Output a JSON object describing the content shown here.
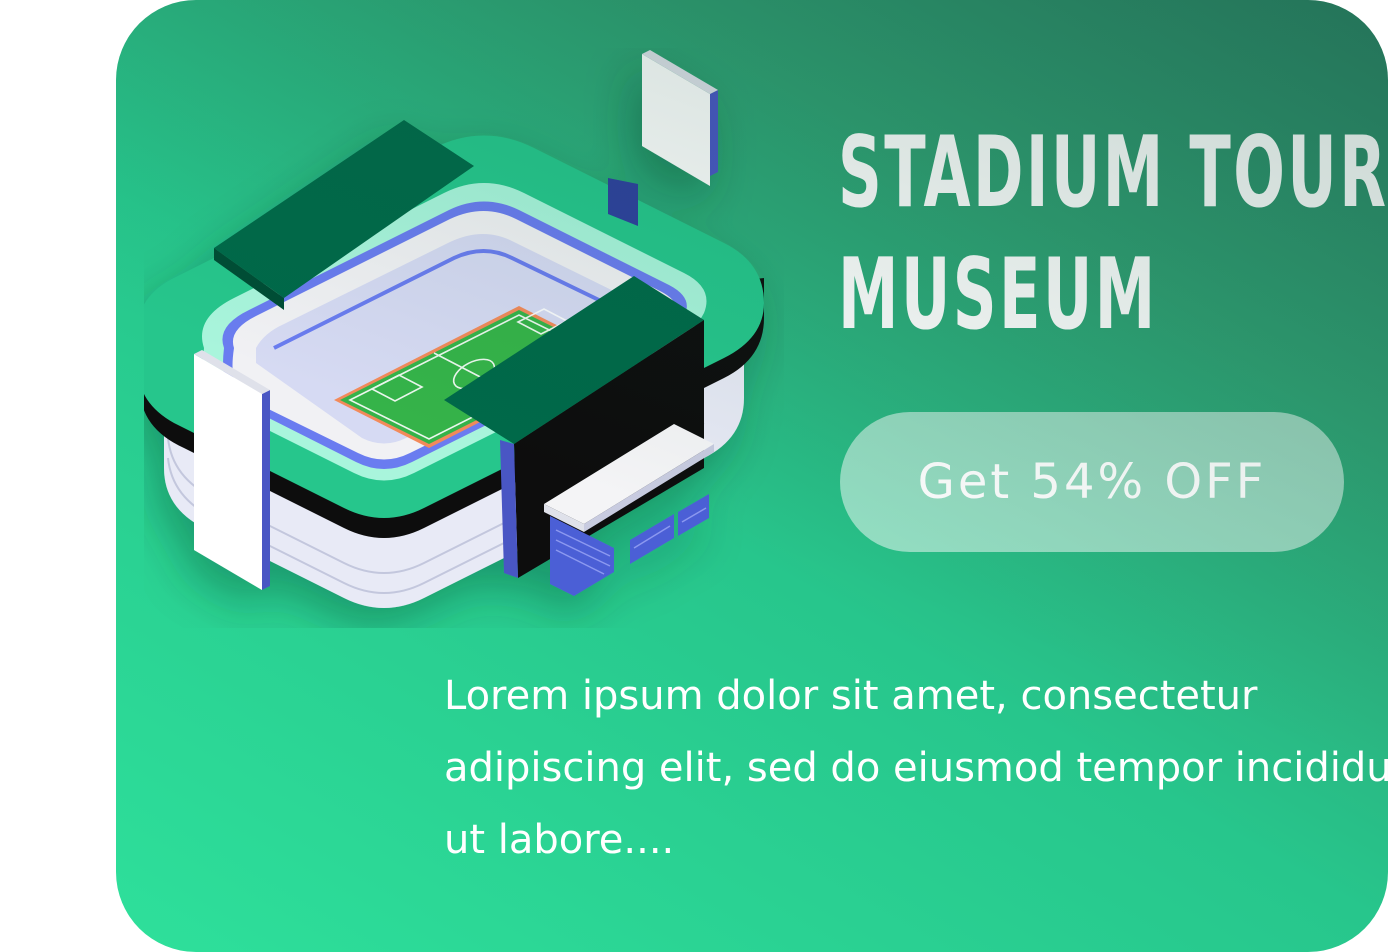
{
  "card": {
    "title_line1": "STADIUM TOUR",
    "title_line2": "MUSEUM",
    "cta_label": "Get 54% OFF",
    "description": "Lorem ipsum dolor sit amet, consectetur adipiscing elit, sed do eiusmod tempor incididunt ut labore....",
    "illustration": "isometric-stadium-icon"
  },
  "colors": {
    "card_gradient_light": "#2ee09b",
    "card_gradient_dark": "#2a7f63",
    "roof_dark_green": "#026a45",
    "stand_green": "#27c68c",
    "pitch_green": "#35b34a",
    "accent_blue": "#5a6fe0",
    "text": "#ffffff"
  }
}
